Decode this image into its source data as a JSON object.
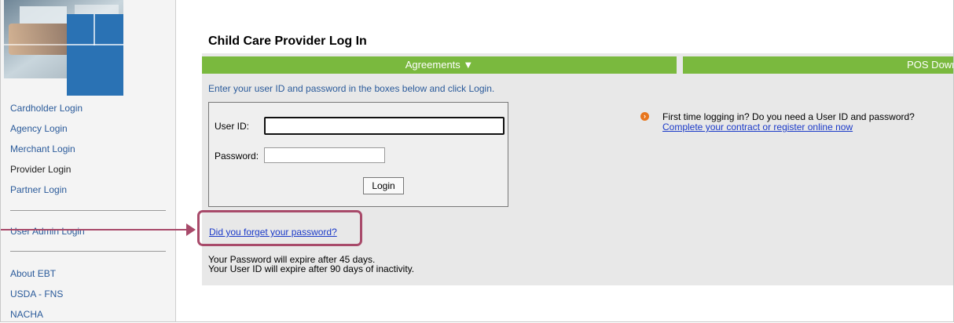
{
  "sidebar": {
    "items": [
      {
        "label": "Cardholder Login"
      },
      {
        "label": "Agency Login"
      },
      {
        "label": "Merchant Login"
      },
      {
        "label": "Provider Login"
      },
      {
        "label": "Partner Login"
      },
      {
        "label": "User Admin Login"
      },
      {
        "label": "About EBT"
      },
      {
        "label": "USDA - FNS"
      },
      {
        "label": "NACHA"
      }
    ]
  },
  "main": {
    "title": "Child Care Provider Log In",
    "tabs": [
      {
        "label": "Agreements ▼"
      },
      {
        "label": "POS Download"
      }
    ],
    "instructions": "Enter your user ID and password in the boxes below and click Login.",
    "form": {
      "user_id_label": "User ID:",
      "user_id_value": "",
      "password_label": "Password:",
      "password_value": "",
      "login_label": "Login"
    },
    "first_time": {
      "question": "First time logging in? Do you need a User ID and password?",
      "link": "Complete your contract or register online now"
    },
    "forgot_link": "Did you forget your password?",
    "expire_notes": [
      "Your Password will expire after 45 days.",
      "Your User ID will expire after 90 days of inactivity."
    ]
  },
  "colors": {
    "tab_green": "#7ab93e",
    "link_blue": "#1a39c8",
    "nav_blue": "#2a5a9a",
    "annotation": "#a84a6a",
    "panel_gray": "#e8e8e8"
  }
}
